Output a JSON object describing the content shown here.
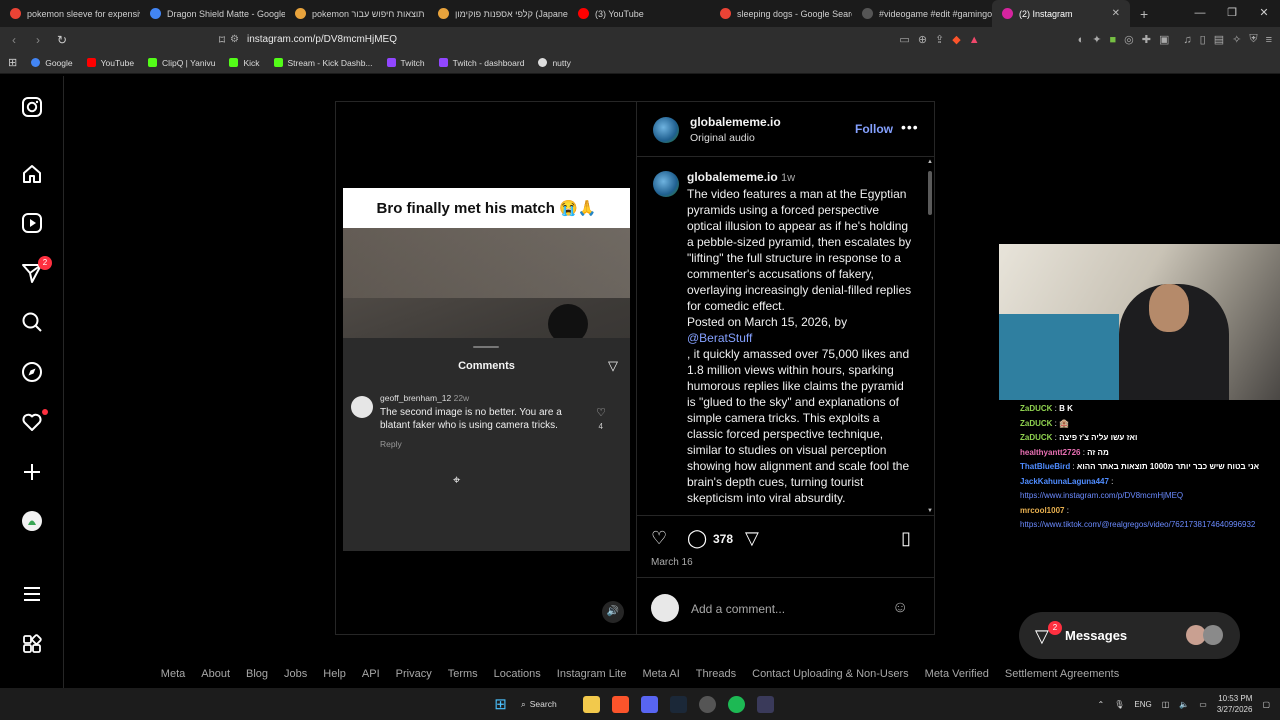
{
  "browser": {
    "tabs": [
      {
        "title": "pokemon sleeve for expensive",
        "color": "#ea4335"
      },
      {
        "title": "Dragon Shield Matte - Google",
        "color": "#ea4335"
      },
      {
        "title": "pokemon תוצאות חיפוש עבור",
        "color": "#e8a33c"
      },
      {
        "title": "קלפי אספנות פוקימון (Japanese)",
        "color": "#e8a33c"
      },
      {
        "title": "(3) YouTube",
        "color": "#ff0000"
      },
      {
        "title": "sleeping dogs - Google Search",
        "color": "#ea4335"
      },
      {
        "title": "#videogame #edit #gamingon",
        "color": "#111111"
      },
      {
        "title": "(2) Instagram",
        "color": "#d6249f"
      }
    ],
    "url": "instagram.com/p/DV8mcmHjMEQ",
    "bookmarks": [
      "Google",
      "YouTube",
      "ClipQ | Yanivu",
      "Kick",
      "Stream - Kick Dashb...",
      "Twitch",
      "Twitch - dashboard",
      "nutty"
    ]
  },
  "sidebar": {
    "notifications_badge": "2",
    "items": [
      "instagram-logo",
      "home-icon",
      "reels-icon",
      "messages-icon",
      "search-icon",
      "explore-icon",
      "notifications-icon",
      "create-icon",
      "profile-icon",
      "more-icon",
      "also-from-meta-icon"
    ]
  },
  "video": {
    "caption": "Bro finally met his match 😭🙏",
    "sheet_title": "Comments",
    "comment_user": "geoff_brenham_12",
    "comment_time": "22w",
    "comment_text": "The second image is no better. You are a blatant faker who is using camera tricks.",
    "comment_likes": "4",
    "reply_label": "Reply"
  },
  "post": {
    "username": "globalememe.io",
    "audio": "Original audio",
    "follow": "Follow",
    "time": "1w",
    "description_1": "The video features a man at the Egyptian pyramids using a forced perspective optical illusion to appear as if he's holding a pebble-sized pyramid, then escalates by \"lifting\" the full structure in response to a commenter's accusations of fakery, overlaying increasingly denial-filled replies for comedic effect.",
    "description_2": "Posted on March 15, 2026, by",
    "mention": "@BeratStuff",
    "description_3": ", it quickly amassed over 75,000 likes and 1.8 million views within hours, sparking humorous replies like claims the pyramid is \"glued to the sky\" and explanations of simple camera tricks. This exploits a classic forced perspective technique, similar to studies on visual perception showing how alignment and scale fool the brain's depth cues, turning tourist skepticism into viral absurdity.",
    "comment_count": "378",
    "date": "March 16",
    "add_comment_placeholder": "Add a comment..."
  },
  "chat": [
    {
      "name": "ZaDUCK",
      "msg": "B K",
      "color": "#8fd14f"
    },
    {
      "name": "ZaDUCK",
      "msg": "🏨",
      "color": "#8fd14f"
    },
    {
      "name": "ZaDUCK",
      "msg": "ואז עשו עליה צ'ז פיצה",
      "color": "#8fd14f"
    },
    {
      "name": "healthyantt2726",
      "msg": "מה זה",
      "color": "#e86fb3"
    },
    {
      "name": "ThatBlueBird",
      "msg": "אני בטוח שיש כבר יותר מ1000 תוצאות באתר ההוא",
      "color": "#4f8cff"
    },
    {
      "name": "JackKahunaLaguna447",
      "msg": "",
      "url": "https://www.instagram.com/p/DV8mcmHjMEQ",
      "color": "#4f8cff"
    },
    {
      "name": "mrcool1007",
      "msg": "",
      "url": "https://www.tiktok.com/@realgregos/video/7621738174640996932",
      "color": "#e8b04f"
    }
  ],
  "messages": {
    "label": "Messages",
    "badge": "2"
  },
  "footer": [
    "Meta",
    "About",
    "Blog",
    "Jobs",
    "Help",
    "API",
    "Privacy",
    "Terms",
    "Locations",
    "Instagram Lite",
    "Meta AI",
    "Threads",
    "Contact Uploading & Non-Users",
    "Meta Verified",
    "Settlement Agreements"
  ],
  "taskbar": {
    "search": "Search",
    "lang": "ENG",
    "time": "10:53 PM",
    "date": "3/27/2026"
  }
}
